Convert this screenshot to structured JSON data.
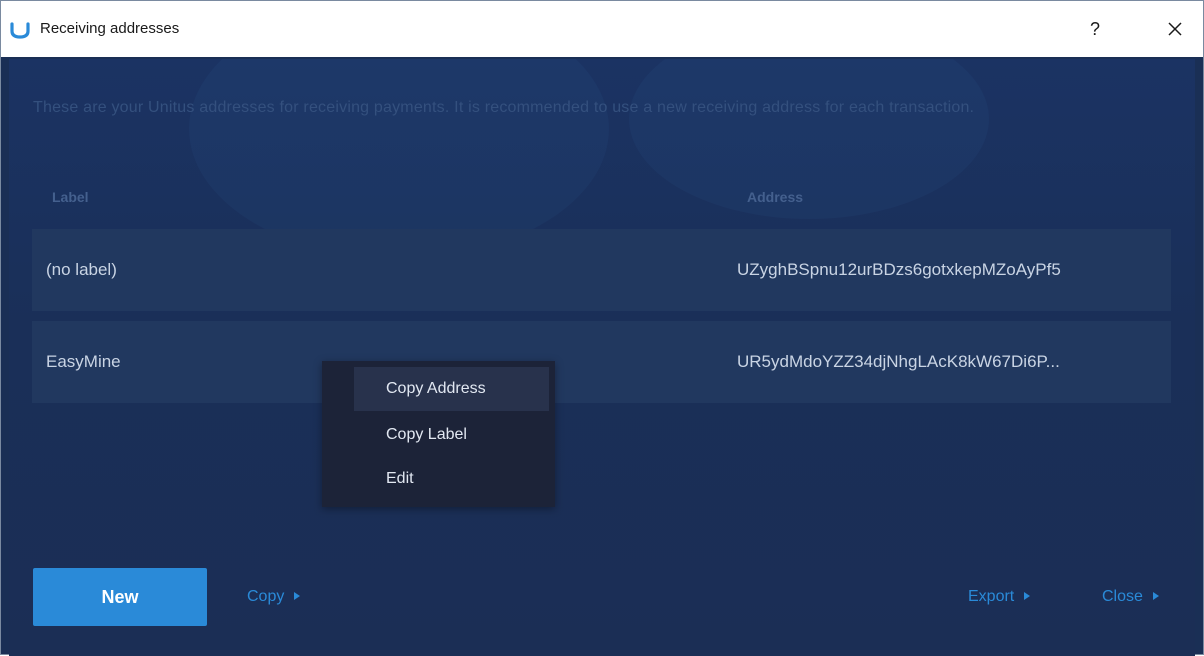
{
  "window": {
    "title": "Receiving addresses",
    "help_label": "?"
  },
  "description": "These are your Unitus addresses for receiving payments. It is recommended to use a new receiving address for each transaction.",
  "table": {
    "columns": [
      "Label",
      "Address"
    ],
    "rows": [
      {
        "label": "(no label)",
        "address": "UZyghBSpnu12urBDzs6gotxkepMZoAyPf5"
      },
      {
        "label": "EasyMine",
        "address": "UR5ydMdoYZZ34djNhgLAcK8kW67Di6P..."
      }
    ]
  },
  "context_menu": {
    "items": [
      "Copy Address",
      "Copy Label",
      "Edit"
    ]
  },
  "buttons": {
    "new": "New",
    "copy": "Copy",
    "export": "Export",
    "close": "Close"
  },
  "colors": {
    "background": "#1a2f58",
    "accent": "#2a8ad8",
    "row": "#21385f",
    "menu": "#1c2338"
  },
  "icons": {
    "app": "unitus-logo-icon",
    "help": "help-icon",
    "close": "close-icon",
    "arrow": "triangle-right-icon"
  }
}
